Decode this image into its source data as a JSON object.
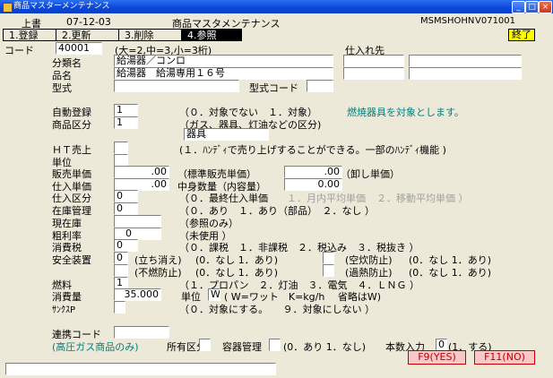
{
  "window": {
    "title": "商品マスターメンテナンス"
  },
  "header": {
    "mode": "上書",
    "date": "07-12-03",
    "screen_title": "商品マスタメンテナンス",
    "program": "MSMSHOHN",
    "version": "V071001",
    "exit_label": "終了"
  },
  "tabs": [
    "1.登録",
    "2.更新",
    "3.削除",
    "4.参照"
  ],
  "code": {
    "label": "コード",
    "value": "40001",
    "note": "(大=2,中=3,小=3桁)"
  },
  "supplier_label": "仕入れ先",
  "category": {
    "label": "分類名",
    "value": "給湯器／コンロ"
  },
  "product_name": {
    "label": "品名",
    "value": "給湯器　給湯専用１６号"
  },
  "model": {
    "label": "型式",
    "code_label": "型式コード",
    "value": "",
    "code_value": ""
  },
  "auto_register": {
    "label": "自動登録",
    "value": "1",
    "options": "（０．対象でない　１．対象）",
    "note": "燃焼器具を対象とします。"
  },
  "product_class": {
    "label": "商品区分",
    "value": "1",
    "options": "（ガス、器具、灯油などの区分)",
    "display": "器具"
  },
  "ht_sales": {
    "label": "ＨＴ売上",
    "value": "",
    "options": "(１．ﾊﾝﾃﾞｨで売り上げすることができる。一部のﾊﾝﾃﾞｨ機能 )"
  },
  "unit": {
    "label": "単位",
    "value": ""
  },
  "sale_price": {
    "label": "販売単価",
    "value": ".00",
    "note": "（標準販売単価）",
    "wholesale_value": ".00",
    "wholesale_note": "（卸し単価）"
  },
  "purchase_price": {
    "label": "仕入単価",
    "value": ".00",
    "content_label": "中身数量（内容量）",
    "content_value": "0.00"
  },
  "purchase_class": {
    "label": "仕入区分",
    "value": "0",
    "opt0": "（０．最終仕入単価",
    "opt1": "１．月内平均単価",
    "opt2": "２．移動平均単価 ）"
  },
  "stock_mgmt": {
    "label": "在庫管理",
    "value": "0",
    "options": "（０．あり　１．あり（部品）　２．なし ）"
  },
  "current_stock": {
    "label": "現在庫",
    "value": "",
    "note": "（参照のみ）"
  },
  "gross_margin": {
    "label": "粗利率",
    "value": "0",
    "note": "（未使用 ）"
  },
  "consumption_tax": {
    "label": "消費税",
    "value": "0",
    "options": "（０．課税　１．非課税　２．税込み　３．税抜き ）"
  },
  "safety": {
    "label": "安全装置",
    "row1_value": "0",
    "row1_a": "(立ち消え)",
    "row1_b": "(0．なし 1．あり)",
    "row1_c": "(空炊防止)",
    "row1_d": "(0．なし 1．あり)",
    "row2_value": "",
    "row2_a": "(不燃防止)",
    "row2_b": "(0．なし 1．あり)",
    "row2_c": "(過熱防止)",
    "row2_d": "(0．なし 1．あり)"
  },
  "fuel": {
    "label": "燃料",
    "value": "1",
    "options": "（１．プロパン　２．灯油　３．電気　４．ＬＮＧ ）"
  },
  "consumption": {
    "label": "消費量",
    "value": "35.000",
    "unit_label": "単位",
    "unit_value": "W",
    "unit_note": "( W=ワット　K=kg/h　 省略はW)"
  },
  "sunkus": {
    "label": "ｻﾝｸｽP",
    "value": "",
    "options": "（０．対象にする。　　９．対象にしない ）"
  },
  "link_code": {
    "label": "連携コード",
    "value": ""
  },
  "high_pressure": {
    "label": "(高圧ガス商品のみ)",
    "ownership_label": "所有区分",
    "ownership_value": "",
    "container_label": "容器管理",
    "container_value": "",
    "container_options": "(0．あり 1．なし)",
    "count_label": "本数入力",
    "count_value": "0",
    "count_options": "(1．する)"
  },
  "function_keys": {
    "f9": "F9(YES)",
    "f11": "F11(NO)"
  },
  "colors": {
    "titlebar": "#0a46d6",
    "note_green": "#008080",
    "exit_yellow": "#ffff00",
    "fkey_red": "#c00000"
  }
}
